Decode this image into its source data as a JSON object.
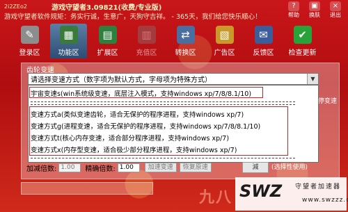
{
  "window": {
    "id_label": "2i2ZEo2",
    "title": "游戏守望者3.09821(收费/专业版)"
  },
  "marquee": "游戏守望者软件规矩：务实行诚，生意广，天狗守吉祥。 - 365天，我们给您快乐顺心！",
  "top_actions": [
    {
      "icon": "help-icon",
      "label": "帮助"
    },
    {
      "icon": "skin-icon",
      "label": "换肤"
    },
    {
      "icon": "close-icon",
      "label": "退出"
    }
  ],
  "tabs": [
    {
      "label": "登录区",
      "icon": "wrench-icon",
      "active": false,
      "faded": false
    },
    {
      "label": "功能区",
      "icon": "chip-icon",
      "active": true,
      "faded": false
    },
    {
      "label": "扩展区",
      "icon": "board-icon",
      "active": false,
      "faded": false
    },
    {
      "label": "充值区",
      "icon": "wallet-icon",
      "active": false,
      "faded": true
    },
    {
      "label": "转换区",
      "icon": "convert-icon",
      "active": false,
      "faded": false
    },
    {
      "label": "广告区",
      "icon": "ad-icon",
      "active": false,
      "faded": false
    },
    {
      "label": "反馈区",
      "icon": "feedback-icon",
      "active": false,
      "faded": false
    },
    {
      "label": "检查更新",
      "icon": "check-icon",
      "active": false,
      "faded": false
    }
  ],
  "panel": {
    "gear_label": "齿轮变速",
    "right_checkbox_label": "时停变速"
  },
  "combo": {
    "selected": "请选择变速方式（数字项为默认方式，字母项为特殊方式）"
  },
  "dropdown": {
    "items": [
      "宇宙变速s(win系统级变速，底层注入模式，支持windows xp/7/8/8.1/10)",
      "变速方式a(类似变速齿轮，适合无保护的程序进程，支持windows xp/7)",
      "变速方式g(进程变速，适合无保护的程序进程，支持windows xp/7/8/8.1/10)",
      "变速方式t(核心内存变速，适合部分程序进程，支持windows xp/7)",
      "变速方式x(内存型变速，适合极少部分程序进程，支持windows xp/7)"
    ]
  },
  "bottom": {
    "accel_label": "加减倍数:",
    "accel_value": "1.00",
    "precise_label": "精确倍数:",
    "precise_value": "1.00",
    "apply_btn": "加速变速",
    "restore_btn": "恢复原速",
    "right_btn": "減",
    "select_hint": "(选择性使用)"
  },
  "watermark": {
    "chinese": "九八",
    "logo": "SWZ",
    "sub1": "守望者加速器",
    "sub2": "www.swzzz.com"
  },
  "colors": {
    "background": "#c9161a",
    "highlight": "#e02020",
    "active_tab": "#3a5f8a"
  }
}
